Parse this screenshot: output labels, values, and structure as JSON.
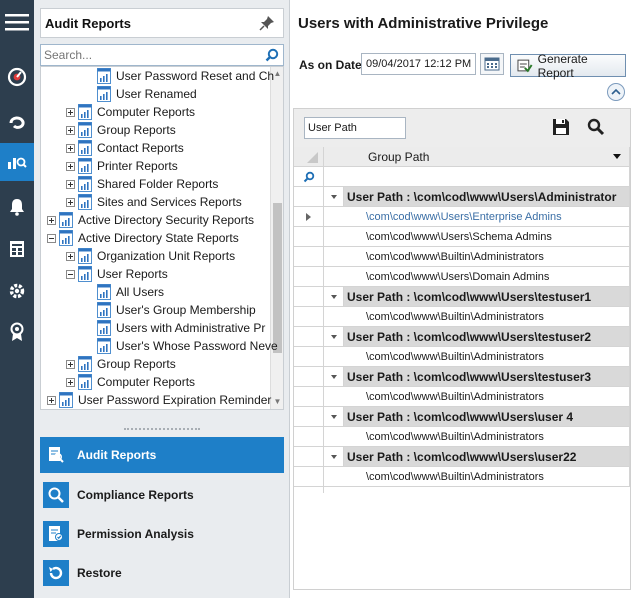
{
  "nav": {
    "title": "Audit Reports",
    "search_placeholder": "Search...",
    "tree": [
      {
        "label": "User Password Reset and Ch",
        "level": 3,
        "expander": "none"
      },
      {
        "label": "User Renamed",
        "level": 3,
        "expander": "none"
      },
      {
        "label": "Computer Reports",
        "level": 2,
        "expander": "plus"
      },
      {
        "label": "Group Reports",
        "level": 2,
        "expander": "plus"
      },
      {
        "label": "Contact Reports",
        "level": 2,
        "expander": "plus"
      },
      {
        "label": "Printer Reports",
        "level": 2,
        "expander": "plus"
      },
      {
        "label": "Shared Folder Reports",
        "level": 2,
        "expander": "plus"
      },
      {
        "label": "Sites and Services Reports",
        "level": 2,
        "expander": "plus"
      },
      {
        "label": "Active Directory Security Reports",
        "level": 1,
        "expander": "plus"
      },
      {
        "label": "Active Directory State Reports",
        "level": 1,
        "expander": "minus"
      },
      {
        "label": "Organization Unit Reports",
        "level": 2,
        "expander": "plus"
      },
      {
        "label": "User Reports",
        "level": 2,
        "expander": "minus"
      },
      {
        "label": "All Users",
        "level": 3,
        "expander": "none"
      },
      {
        "label": "User's Group Membership",
        "level": 3,
        "expander": "none"
      },
      {
        "label": "Users with Administrative Pr",
        "level": 3,
        "expander": "none"
      },
      {
        "label": "User's Whose Password Neve",
        "level": 3,
        "expander": "none"
      },
      {
        "label": "Group Reports",
        "level": 2,
        "expander": "plus"
      },
      {
        "label": "Computer Reports",
        "level": 2,
        "expander": "plus"
      },
      {
        "label": "User Password Expiration Reminder",
        "level": 1,
        "expander": "plus"
      }
    ],
    "modules": [
      {
        "label": "Audit Reports",
        "icon": "audit-report-icon",
        "active": true
      },
      {
        "label": "Compliance Reports",
        "icon": "magnifier-icon",
        "active": false
      },
      {
        "label": "Permission Analysis",
        "icon": "permission-icon",
        "active": false
      },
      {
        "label": "Restore",
        "icon": "restore-icon",
        "active": false
      }
    ]
  },
  "main": {
    "title": "Users with Administrative Privilege",
    "date_label": "As on Date:",
    "date_value": "09/04/2017 12:12 PM",
    "generate_label": "Generate Report",
    "group_by_chip": "User Path",
    "column_header": "Group Path",
    "groups": [
      {
        "label": "User Path : \\com\\cod\\www\\Users\\Administrator",
        "rows": [
          "\\com\\cod\\www\\Users\\Enterprise Admins",
          "\\com\\cod\\www\\Users\\Schema Admins",
          "\\com\\cod\\www\\Builtin\\Administrators",
          "\\com\\cod\\www\\Users\\Domain Admins"
        ]
      },
      {
        "label": "User Path : \\com\\cod\\www\\Users\\testuser1",
        "rows": [
          "\\com\\cod\\www\\Builtin\\Administrators"
        ]
      },
      {
        "label": "User Path : \\com\\cod\\www\\Users\\testuser2",
        "rows": [
          "\\com\\cod\\www\\Builtin\\Administrators"
        ]
      },
      {
        "label": "User Path : \\com\\cod\\www\\Users\\testuser3",
        "rows": [
          "\\com\\cod\\www\\Builtin\\Administrators"
        ]
      },
      {
        "label": "User Path : \\com\\cod\\www\\Users\\user 4",
        "rows": [
          "\\com\\cod\\www\\Builtin\\Administrators"
        ]
      },
      {
        "label": "User Path : \\com\\cod\\www\\Users\\user22",
        "rows": [
          "\\com\\cod\\www\\Builtin\\Administrators"
        ]
      }
    ]
  },
  "colors": {
    "accent": "#1e7fc8",
    "rail": "#2d3e4e",
    "group_row": "#d9d9d9"
  }
}
